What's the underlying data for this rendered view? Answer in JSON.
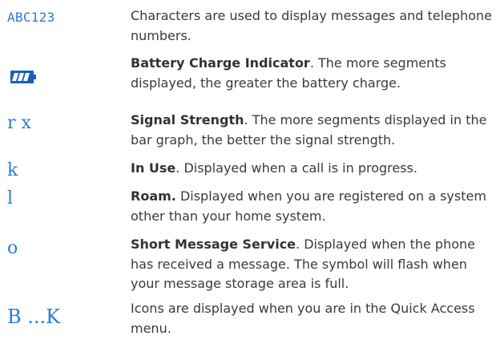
{
  "rows": [
    {
      "symbol": "ABC123",
      "title": "",
      "text": "Characters are used to display messages and telephone numbers."
    },
    {
      "symbol_icon": "battery-charge-icon",
      "title": "Battery Charge Indicator",
      "text": ". The more segments displayed, the greater the battery charge."
    },
    {
      "symbol": "r x",
      "title": "Signal Strength",
      "text": ". The more segments displayed in the bar graph, the better the signal strength."
    },
    {
      "symbol": "k",
      "title": "In Use",
      "text": ". Displayed when a call is in progress."
    },
    {
      "symbol": "l",
      "title": "Roam.",
      "text": " Displayed when you are registered on a system other than your home system."
    },
    {
      "symbol": "o",
      "title": "Short Message Service",
      "text": ". Displayed when the phone has received a message. The symbol will flash when your message storage area is full."
    },
    {
      "symbol": "B ...K",
      "title": "",
      "text": "Icons are displayed when you are in the Quick Access menu."
    }
  ],
  "colors": {
    "symbol": "#2b7bd6",
    "text": "#3a3a3a"
  }
}
